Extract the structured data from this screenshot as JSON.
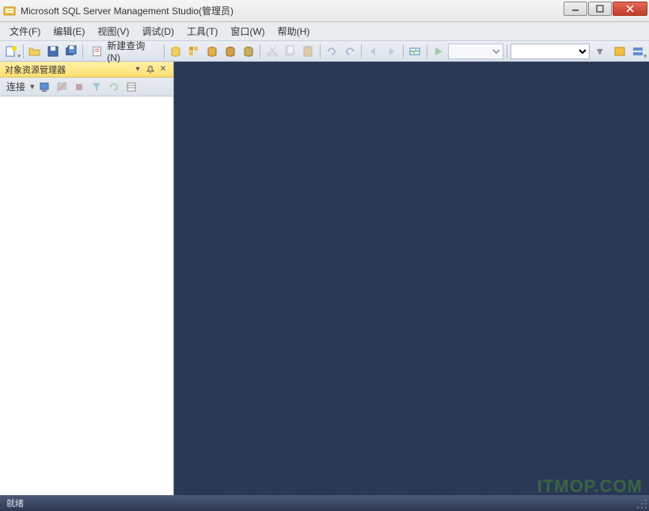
{
  "title": "Microsoft SQL Server Management Studio(管理员)",
  "menu": {
    "file": "文件(F)",
    "edit": "编辑(E)",
    "view": "视图(V)",
    "debug": "调试(D)",
    "tools": "工具(T)",
    "window": "窗口(W)",
    "help": "帮助(H)"
  },
  "toolbar": {
    "new_query": "新建查询(N)"
  },
  "object_explorer": {
    "title": "对象资源管理器",
    "connect": "连接"
  },
  "statusbar": {
    "ready": "就绪"
  },
  "watermark": "ITMOP.COM"
}
